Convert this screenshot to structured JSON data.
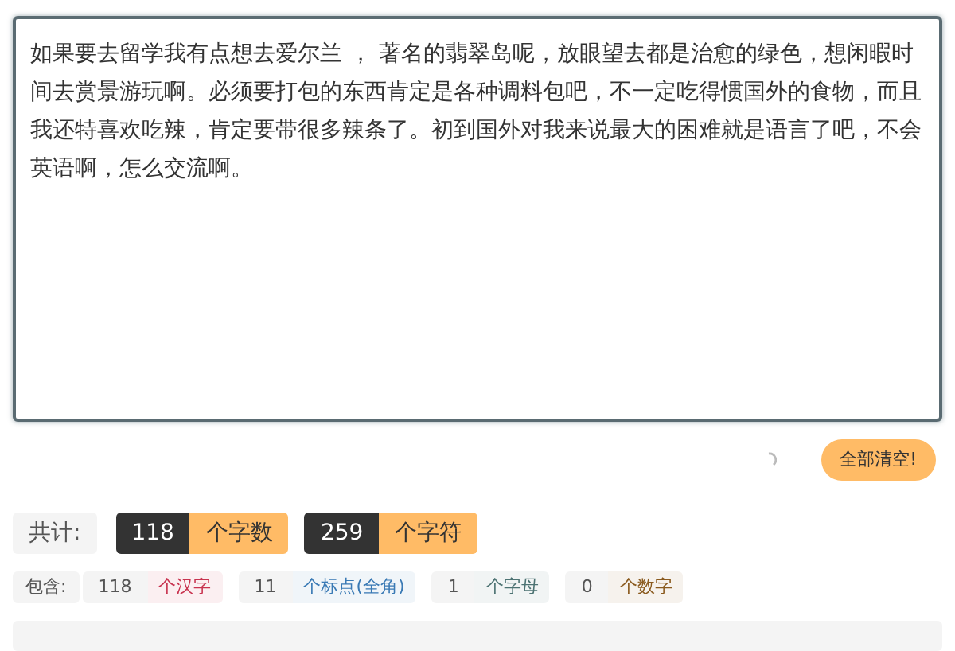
{
  "editor": {
    "value": "如果要去留学我有点想去爱尔兰 ， 著名的翡翠岛呢，放眼望去都是治愈的绿色，想闲暇时间去赏景游玩啊。必须要打包的东西肯定是各种调料包吧，不一定吃得惯国外的食物，而且我还特喜欢吃辣，肯定要带很多辣条了。初到国外对我来说最大的困难就是语言了吧，不会英语啊，怎么交流啊。"
  },
  "clear_button": "全部清空!",
  "totals": {
    "label": "共计:",
    "items": [
      {
        "count": "118",
        "unit": "个字数"
      },
      {
        "count": "259",
        "unit": "个字符"
      }
    ]
  },
  "breakdown": {
    "label": "包含:",
    "items": [
      {
        "count": "118",
        "unit": "个汉字",
        "color": "#c8334f"
      },
      {
        "count": "11",
        "unit": "个标点(全角)",
        "color": "#3a7ab5"
      },
      {
        "count": "1",
        "unit": "个字母",
        "color": "#4d7373"
      },
      {
        "count": "0",
        "unit": "个数字",
        "color": "#8a5a1e"
      }
    ]
  }
}
